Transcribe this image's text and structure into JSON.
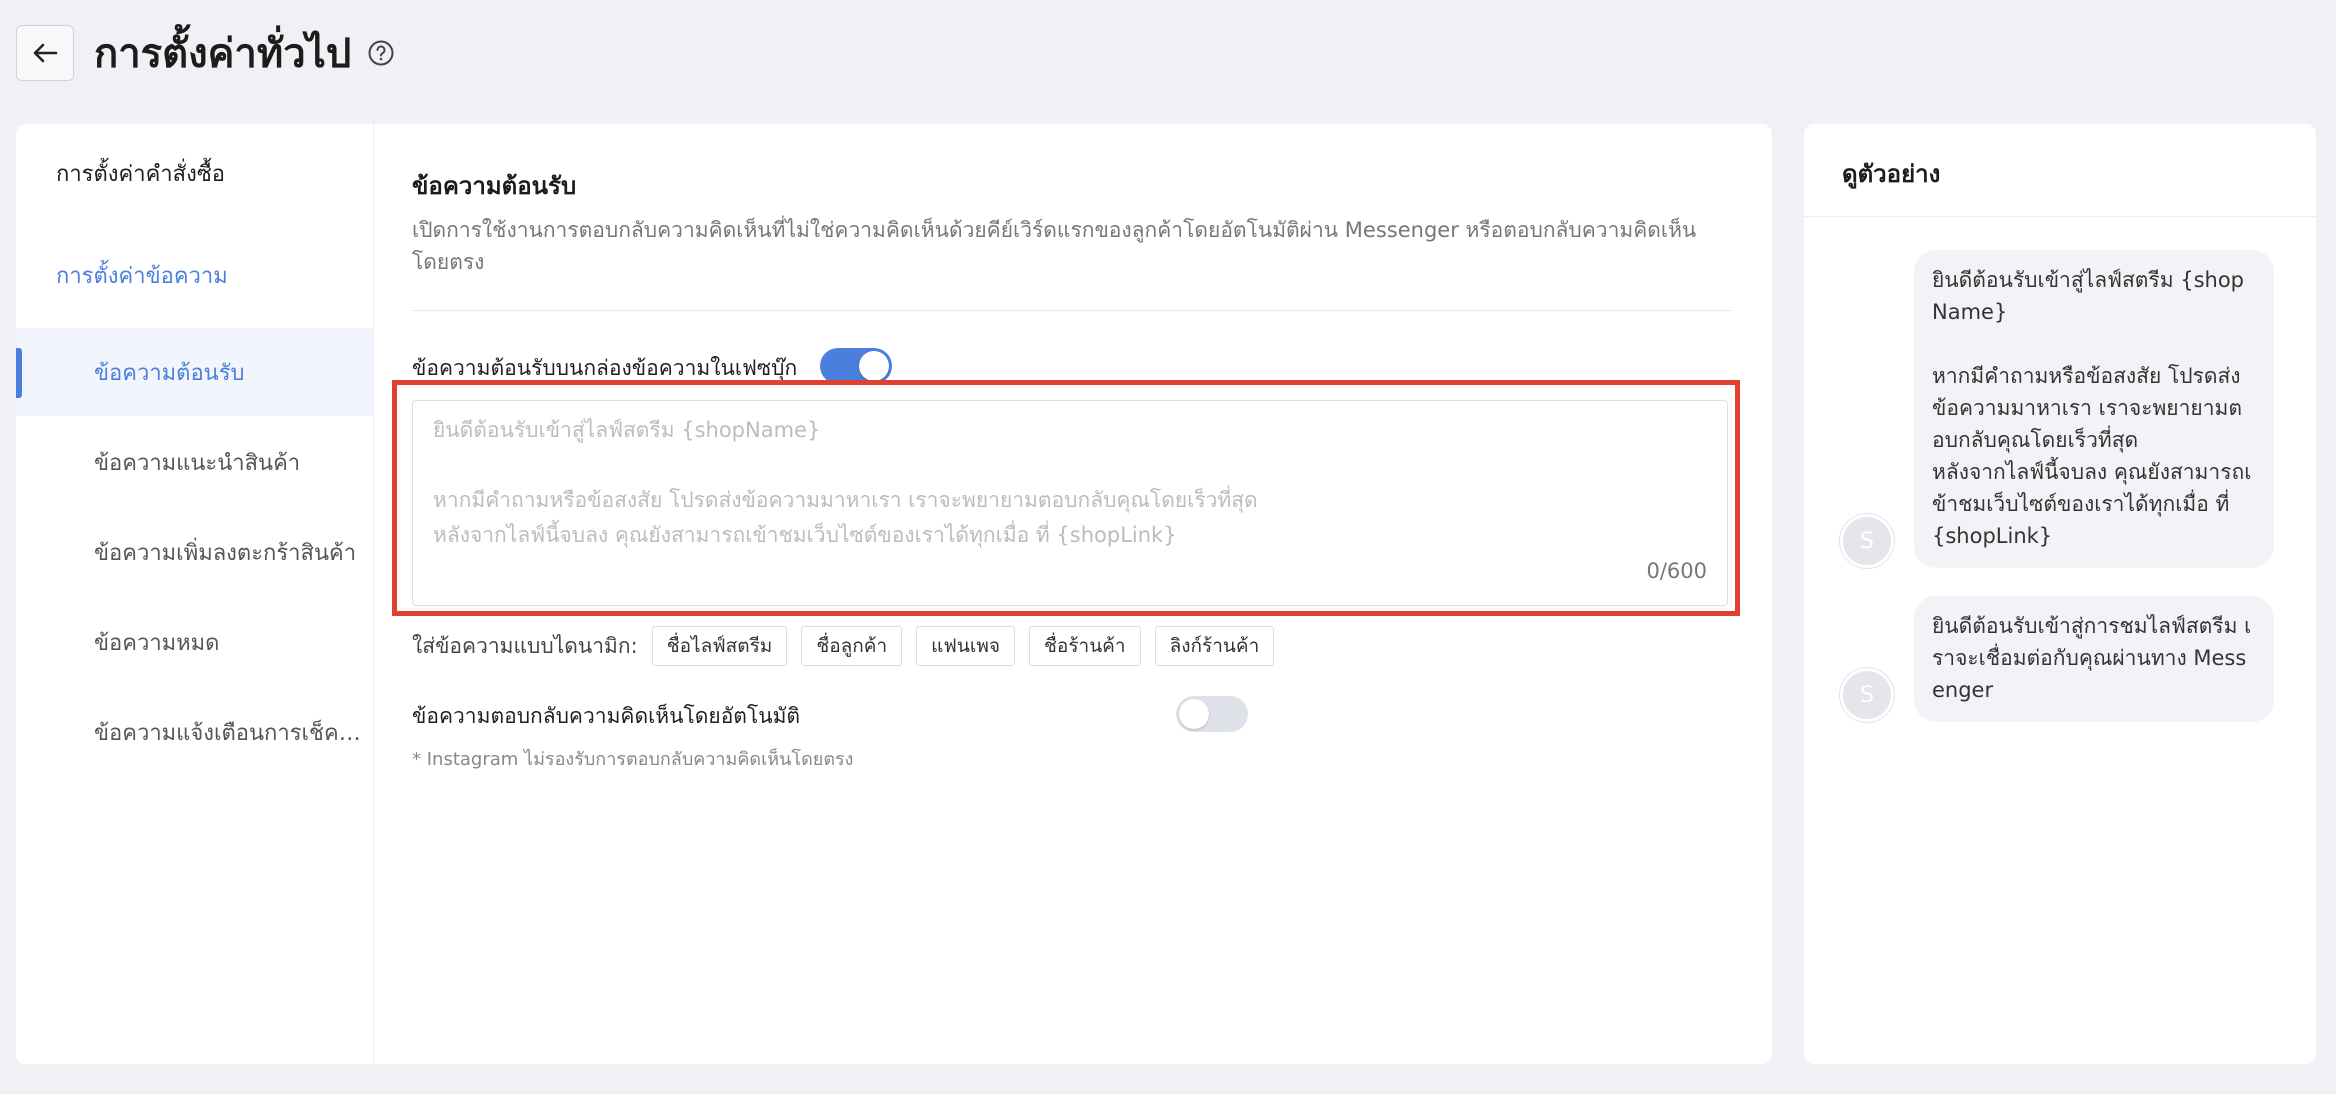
{
  "header": {
    "title": "การตั้งค่าทั่วไป"
  },
  "sidebar": {
    "groups": [
      {
        "label": "การตั้งค่าคำสั่งซื้อ"
      },
      {
        "label": "การตั้งค่าข้อความ"
      }
    ],
    "items": [
      {
        "label": "ข้อความต้อนรับ"
      },
      {
        "label": "ข้อความแนะนำสินค้า"
      },
      {
        "label": "ข้อความเพิ่มลงตะกร้าสินค้า"
      },
      {
        "label": "ข้อความหมด"
      },
      {
        "label": "ข้อความแจ้งเตือนการเช็คเอาท์"
      }
    ]
  },
  "main": {
    "title": "ข้อความต้อนรับ",
    "description": "เปิดการใช้งานการตอบกลับความคิดเห็นที่ไม่ใช่ความคิดเห็นด้วยคีย์เวิร์ดแรกของลูกค้าโดยอัตโนมัติผ่าน Messenger หรือตอบกลับความคิดเห็นโดยตรง",
    "facebook_toggle_label": "ข้อความต้อนรับบนกล่องข้อความในเฟซบุ๊ก",
    "facebook_toggle_on": true,
    "textarea_placeholder": "ยินดีต้อนรับเข้าสู่ไลฟ์สตรีม {shopName}\n\nหากมีคำถามหรือข้อสงสัย โปรดส่งข้อความมาหาเรา เราจะพยายามตอบกลับคุณโดยเร็วที่สุด\nหลังจากไลฟ์นี้จบลง คุณยังสามารถเข้าชมเว็บไซต์ของเราได้ทุกเมื่อ ที่ {shopLink}",
    "char_count": "0/600",
    "dynamic_label": "ใส่ข้อความแบบไดนามิก:",
    "dynamic_tags": [
      "ชื่อไลฟ์สตรีม",
      "ชื่อลูกค้า",
      "แฟนเพจ",
      "ชื่อร้านค้า",
      "ลิงก์ร้านค้า"
    ],
    "auto_reply_label": "ข้อความตอบกลับความคิดเห็นโดยอัตโนมัติ",
    "auto_reply_on": false,
    "footnote": "* Instagram ไม่รองรับการตอบกลับความคิดเห็นโดยตรง"
  },
  "preview": {
    "title": "ดูตัวอย่าง",
    "messages": [
      {
        "avatar": "S",
        "text": "ยินดีต้อนรับเข้าสู่ไลฟ์สตรีม {shopName}\n\nหากมีคำถามหรือข้อสงสัย โปรดส่งข้อความมาหาเรา เราจะพยายามตอบกลับคุณโดยเร็วที่สุด\nหลังจากไลฟ์นี้จบลง คุณยังสามารถเข้าชมเว็บไซต์ของเราได้ทุกเมื่อ ที่ {shopLink}"
      },
      {
        "avatar": "S",
        "text": "ยินดีต้อนรับเข้าสู่การชมไลฟ์สตรีม เราจะเชื่อมต่อกับคุณผ่านทาง Messenger"
      }
    ]
  },
  "colors": {
    "accent": "#4a7fde",
    "highlight": "#e0402f",
    "background": "#f0f1f5"
  }
}
